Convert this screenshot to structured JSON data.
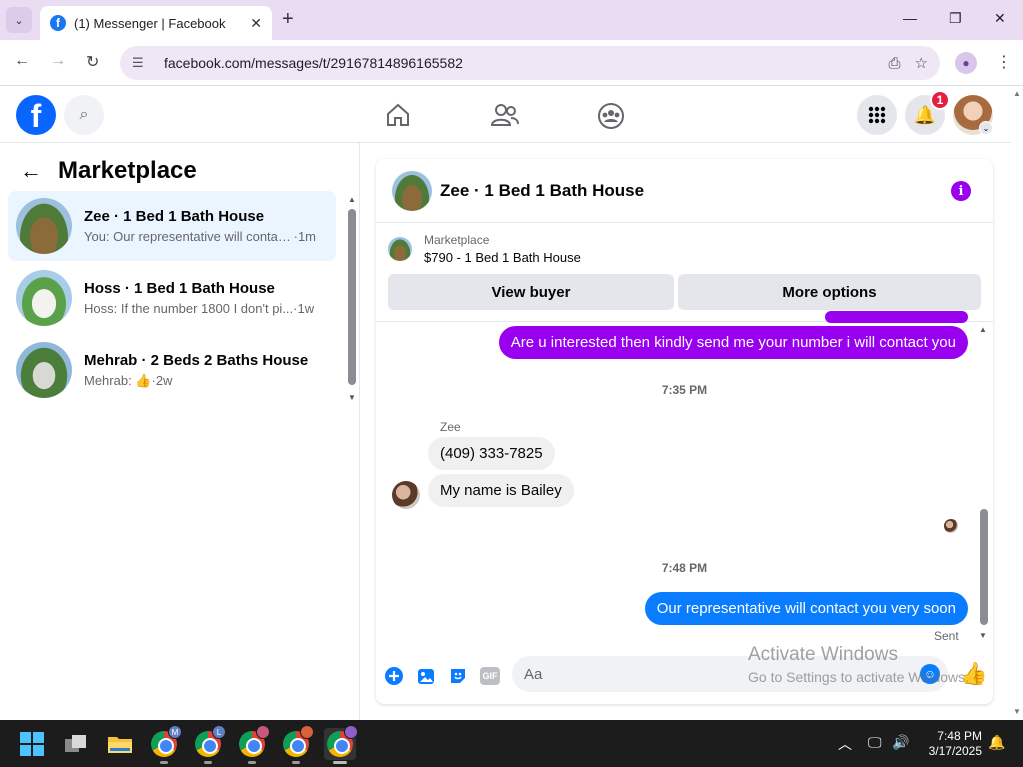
{
  "browser": {
    "tab_title": "(1) Messenger | Facebook",
    "url": "facebook.com/messages/t/29167814896165582"
  },
  "fb": {
    "notification_count": "1"
  },
  "sidebar": {
    "title": "Marketplace",
    "conversations": [
      {
        "name": "Zee · 1 Bed 1 Bath House",
        "preview": "You: Our representative will contac...",
        "time": "·1m",
        "active": true
      },
      {
        "name": "Hoss · 1 Bed 1 Bath House",
        "preview": "Hoss: If the number 1800 I don't pi...",
        "time": "·1w",
        "active": false
      },
      {
        "name": "Mehrab · 2 Beds 2 Baths House",
        "preview": "Mehrab: 👍",
        "time": "·2w",
        "active": false
      }
    ]
  },
  "chat": {
    "title": "Zee · 1 Bed 1 Bath House",
    "marketplace_label": "Marketplace",
    "listing": "$790 - 1 Bed 1 Bath House",
    "view_buyer": "View buyer",
    "more_options": "More options",
    "messages": {
      "out1": "Are u interested then kindly send me your number i will contact you",
      "time1": "7:35 PM",
      "sender": "Zee",
      "in1": "(409) 333-7825",
      "in2": "My name is Bailey",
      "time2": "7:48 PM",
      "out2": "Our representative will contact you very soon",
      "status": "Sent"
    },
    "composer_placeholder": "Aa",
    "gif_label": "GIF"
  },
  "watermark": {
    "line1": "Activate Windows",
    "line2": "Go to Settings to activate Windows."
  },
  "taskbar": {
    "time": "7:48 PM",
    "date": "3/17/2025",
    "badges": [
      "M",
      "L"
    ]
  },
  "colors": {
    "fb_blue": "#0866ff",
    "messenger_purple": "#9900ef",
    "messenger_blue": "#0a7cff",
    "notification_red": "#e41e3f"
  }
}
